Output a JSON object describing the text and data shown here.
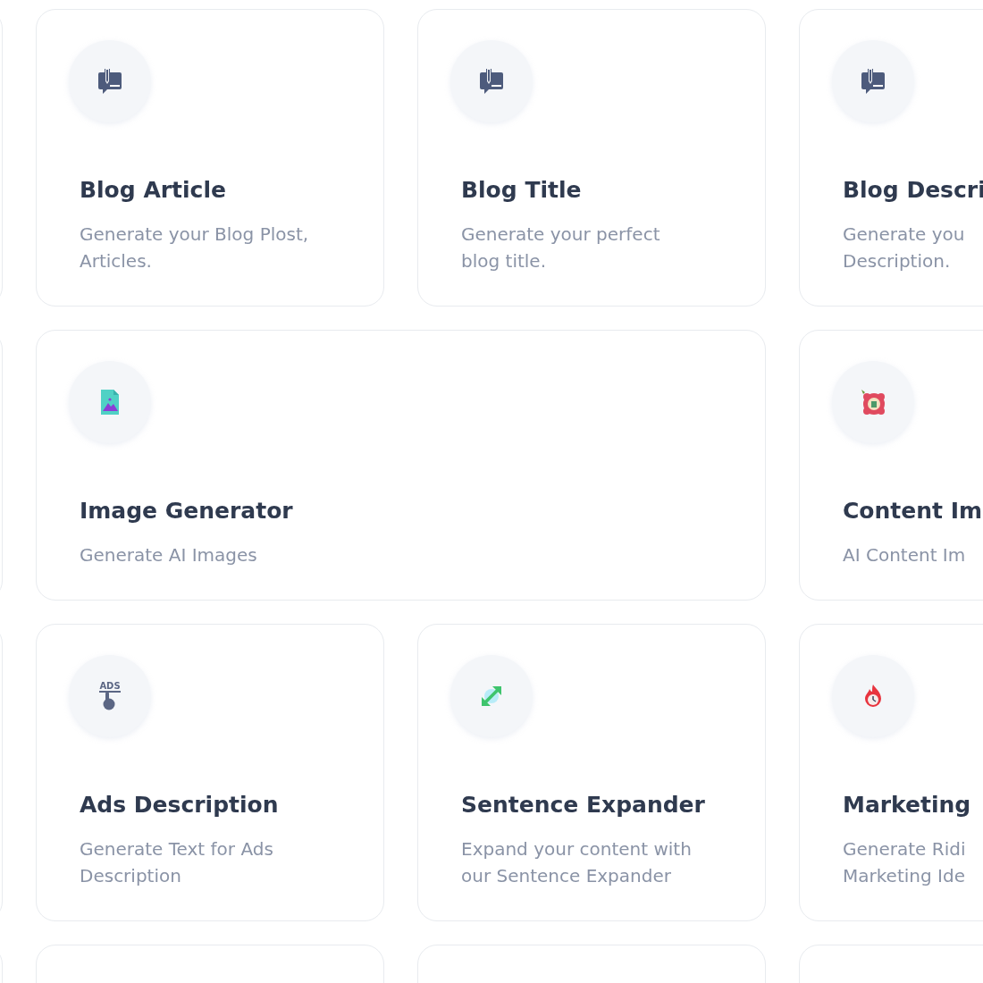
{
  "rows": [
    {
      "cards": [
        {
          "kind": "edge"
        },
        {
          "kind": "normal",
          "icon": {
            "kind": "book-chat"
          },
          "title": "Blog Article",
          "description": [
            "Generate your Blog Plost,",
            "Articles."
          ]
        },
        {
          "kind": "normal",
          "icon": {
            "kind": "book-chat"
          },
          "title": "Blog Title",
          "description": [
            "Generate your perfect",
            "blog title."
          ]
        },
        {
          "kind": "normal",
          "icon": {
            "kind": "book-chat"
          },
          "title": "Blog Descri",
          "description": [
            "Generate you",
            "Description."
          ]
        }
      ]
    },
    {
      "cards": [
        {
          "kind": "edge"
        },
        {
          "kind": "wide",
          "icon": {
            "kind": "image-file"
          },
          "title": "Image Generator",
          "description": [
            "Generate AI Images"
          ]
        },
        {
          "kind": "normal",
          "icon": {
            "kind": "badge"
          },
          "title": "Content Im",
          "description": [
            "AI Content Im"
          ]
        }
      ]
    },
    {
      "cards": [
        {
          "kind": "edge"
        },
        {
          "kind": "normal",
          "icon": {
            "kind": "ads",
            "text": "ADS"
          },
          "title": "Ads Description",
          "description": [
            "Generate Text for Ads",
            "Description"
          ]
        },
        {
          "kind": "normal",
          "icon": {
            "kind": "expand"
          },
          "title": "Sentence Expander",
          "description": [
            "Expand your content with",
            "our Sentence Expander"
          ]
        },
        {
          "kind": "normal",
          "icon": {
            "kind": "flame-clock"
          },
          "title": "Marketing",
          "description": [
            "Generate Ridi",
            "Marketing Ide"
          ]
        }
      ]
    },
    {
      "cards": [
        {
          "kind": "edge"
        },
        {
          "kind": "normal"
        },
        {
          "kind": "normal"
        },
        {
          "kind": "normal"
        }
      ]
    }
  ]
}
